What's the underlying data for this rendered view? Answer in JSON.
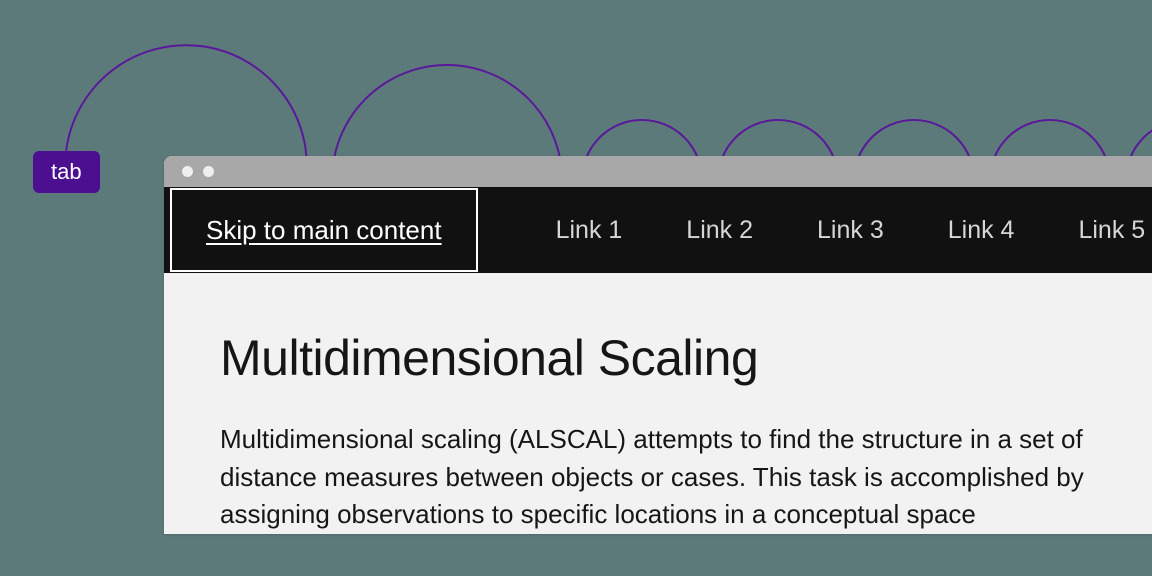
{
  "tab_key": {
    "label": "tab"
  },
  "nav": {
    "skip_label": "Skip to main content",
    "links": [
      "Link 1",
      "Link 2",
      "Link 3",
      "Link 4",
      "Link 5"
    ]
  },
  "page": {
    "title": "Multidimensional Scaling",
    "body": "Multidimensional scaling (ALSCAL) attempts to find the structure in a set of distance measures between objects or cases. This task is accomplished by assigning observations to specific locations in a conceptual space"
  },
  "colors": {
    "accent": "#4b0f8f",
    "arc": "#5a189a"
  }
}
